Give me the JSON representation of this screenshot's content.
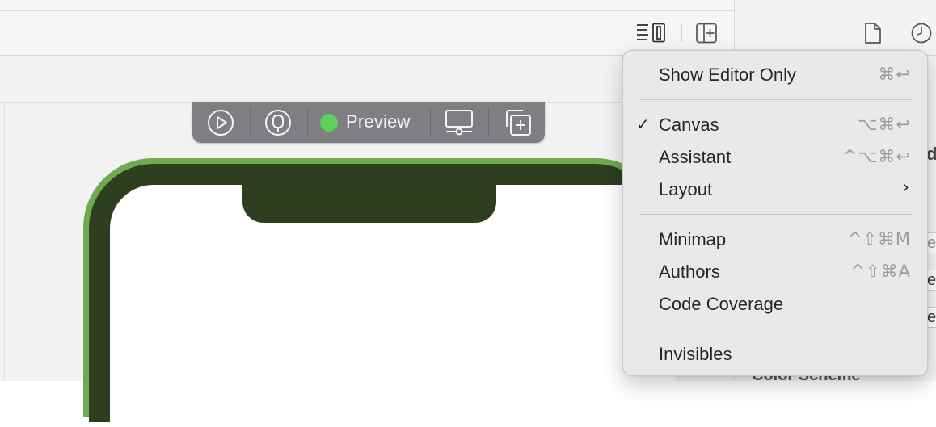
{
  "toolbar": {
    "icons": [
      "editor-options-icon",
      "add-editor-icon"
    ]
  },
  "inspector": {
    "icons": [
      "file-inspector-icon",
      "history-icon"
    ],
    "partial_fields": [
      "e",
      "e",
      "e"
    ],
    "partial_heading": "Color Scheme"
  },
  "preview_bar": {
    "label": "Preview",
    "status_color": "#5cd15c",
    "icons": [
      "live-preview-icon",
      "selectable-icon",
      "device-settings-icon",
      "duplicate-preview-icon"
    ]
  },
  "device": {
    "frame_color": "#6cab4e",
    "bezel_color": "#2d3f1f"
  },
  "menu": {
    "items": [
      {
        "label": "Show Editor Only",
        "shortcut": "⌘↩",
        "checked": false
      },
      {
        "label": "Canvas",
        "shortcut": "⌥⌘↩",
        "checked": true,
        "check": "✓"
      },
      {
        "label": "Assistant",
        "shortcut": "^⌥⌘↩",
        "checked": false
      },
      {
        "label": "Layout",
        "submenu_arrow": "›"
      },
      {
        "label": "Minimap",
        "shortcut": "^⇧⌘M"
      },
      {
        "label": "Authors",
        "shortcut": "^⇧⌘A"
      },
      {
        "label": "Code Coverage"
      },
      {
        "label": "Invisibles"
      }
    ]
  }
}
